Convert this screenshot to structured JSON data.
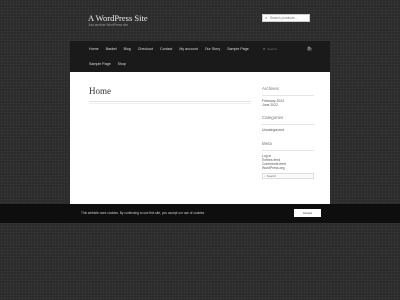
{
  "header": {
    "site_title": "A WordPress Site",
    "tagline": "Just another WordPress site",
    "search_placeholder": "Search products…"
  },
  "nav": {
    "row1": [
      "Home",
      "Basket",
      "Blog",
      "Checkout",
      "Contact",
      "My account",
      "Our Story",
      "Sample Page"
    ],
    "row2": [
      "Sample Page",
      "Shop"
    ],
    "search_placeholder": "Search…",
    "icons": [
      "search-icon",
      "cart-icon"
    ]
  },
  "page": {
    "title": "Home"
  },
  "sidebar": {
    "archives_title": "Archives",
    "archives": [
      "February 2024",
      "June 2022"
    ],
    "categories_title": "Categories",
    "categories": [
      "Uncategorized"
    ],
    "meta_title": "Meta",
    "meta": [
      "Log in",
      "Entries feed",
      "Comments feed",
      "WordPress.org"
    ],
    "search_placeholder": "Search"
  },
  "cookie": {
    "text": "This website uses cookies. By continuing to use this site, you accept our use of cookies.",
    "button": "Accept"
  },
  "colors": {
    "background": "#2b2b2b",
    "nav": "#1a1a1a",
    "cookie_bar": "#0e0e0e"
  }
}
